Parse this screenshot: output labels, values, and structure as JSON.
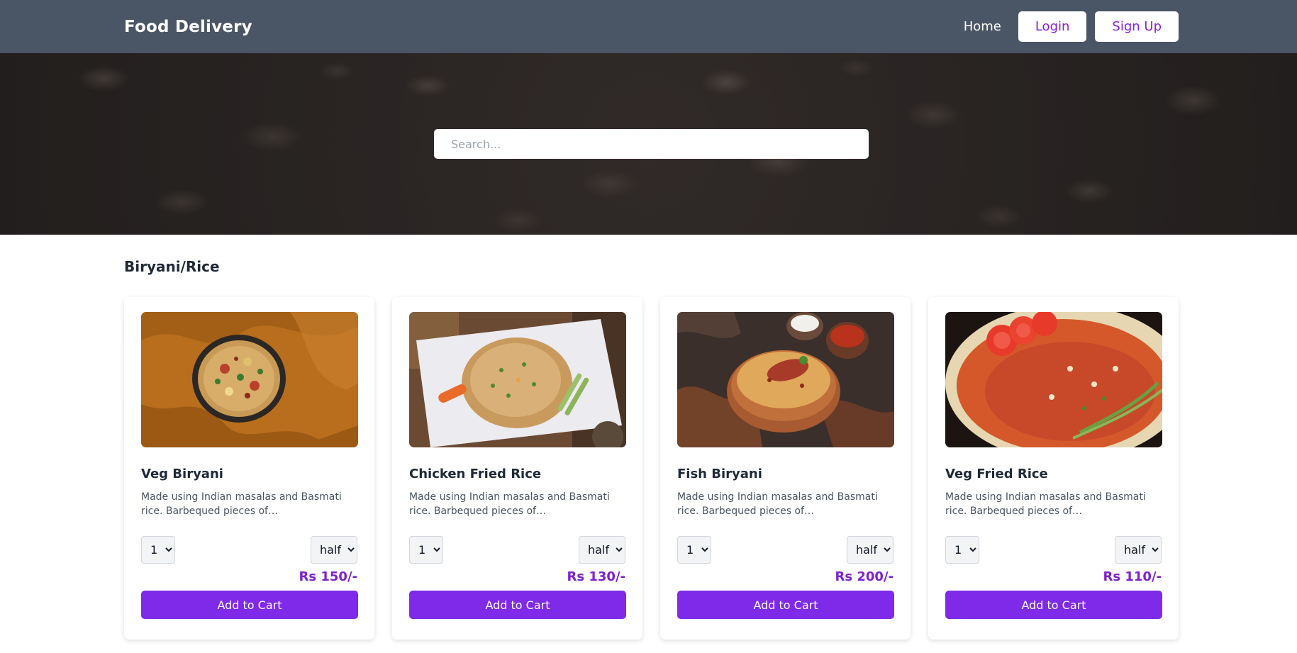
{
  "navbar": {
    "brand": "Food Delivery",
    "home_label": "Home",
    "login_label": "Login",
    "signup_label": "Sign Up"
  },
  "hero": {
    "search_placeholder": "Search..."
  },
  "section": {
    "title": "Biryani/Rice"
  },
  "colors": {
    "navbar_bg": "#4a5565",
    "accent": "#7e2ae8",
    "price": "#7e22ce",
    "nav_button_text": "#8a1fd6"
  },
  "items": [
    {
      "name": "Veg Biryani",
      "description": "Made using Indian masalas and Basmati rice. Barbequed pieces of Paneer/Chicken/Mutton were added.",
      "qty": "1",
      "size": "half",
      "price": "Rs 150/-",
      "button_label": "Add to Cart"
    },
    {
      "name": "Chicken Fried Rice",
      "description": "Made using Indian masalas and Basmati rice. Barbequed pieces of Paneer/Chicken/Mutton were added.",
      "qty": "1",
      "size": "half",
      "price": "Rs 130/-",
      "button_label": "Add to Cart"
    },
    {
      "name": "Fish Biryani",
      "description": "Made using Indian masalas and Basmati rice. Barbequed pieces of Paneer/Chicken/Mutton were added.",
      "qty": "1",
      "size": "half",
      "price": "Rs 200/-",
      "button_label": "Add to Cart"
    },
    {
      "name": "Veg Fried Rice",
      "description": "Made using Indian masalas and Basmati rice. Barbequed pieces of Paneer/Chicken/Mutton were added.",
      "qty": "1",
      "size": "half",
      "price": "Rs 110/-",
      "button_label": "Add to Cart"
    }
  ]
}
